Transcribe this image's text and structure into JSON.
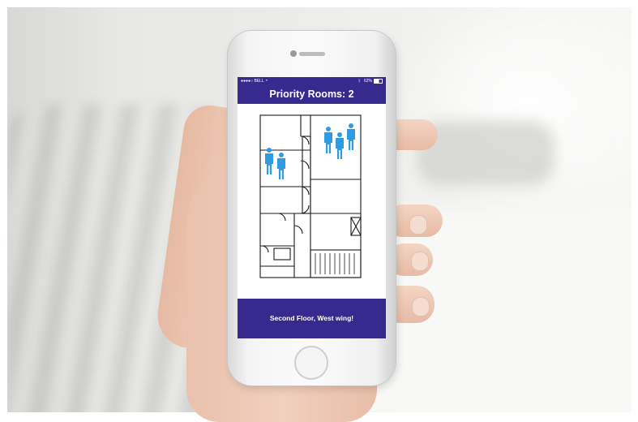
{
  "status_bar": {
    "carrier": "●●●●○ BELL",
    "wifi_icon": "wifi-icon",
    "bluetooth_icon": "bluetooth-icon",
    "battery": "62%"
  },
  "app": {
    "title": "Priority Rooms: 2",
    "footer_message": "Second Floor, West wing!"
  },
  "floorplan": {
    "priority_rooms": [
      {
        "room": "north-east room",
        "people": 3
      },
      {
        "room": "west room",
        "people": 2
      }
    ]
  },
  "colors": {
    "header": "#37298e",
    "person_icon": "#2f9be0",
    "walls": "#1a1a1a"
  }
}
